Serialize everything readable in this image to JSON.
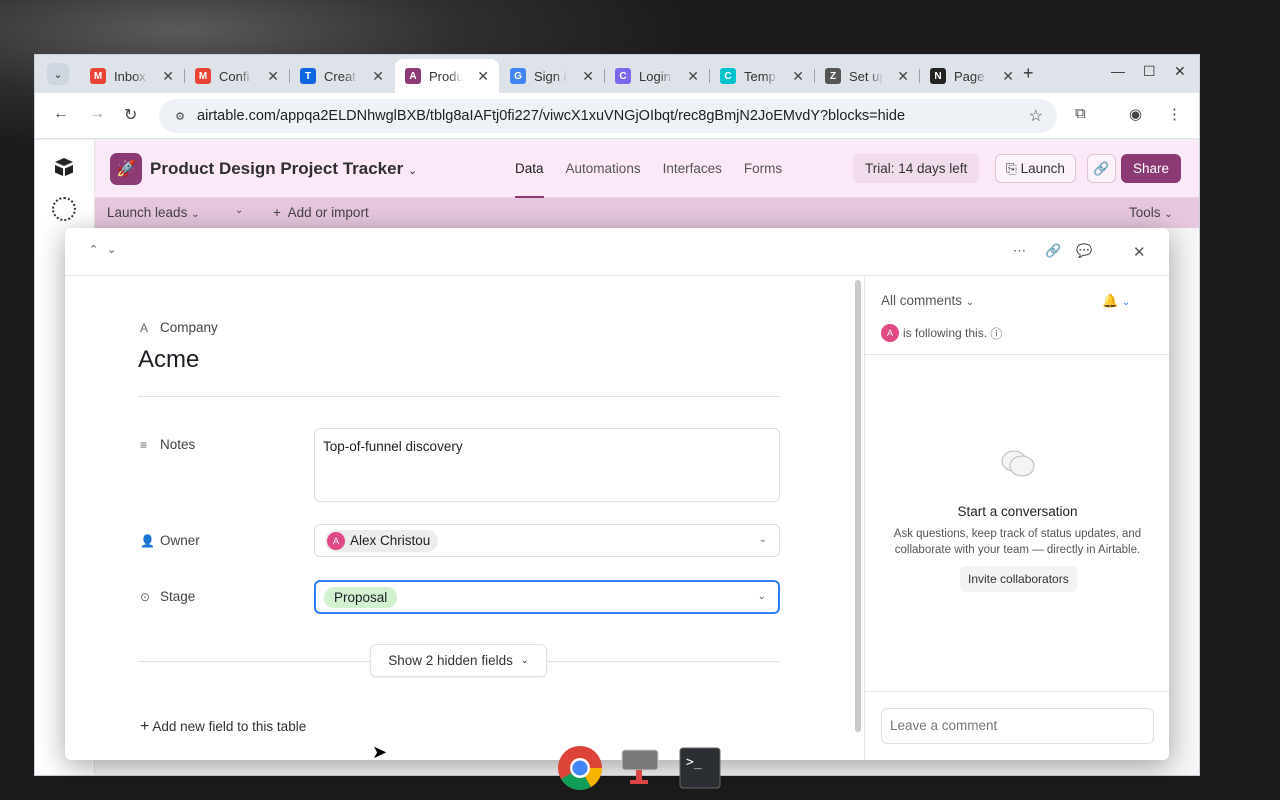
{
  "browser": {
    "tabs": [
      {
        "title": "Inbox",
        "icon": "gmail-icon",
        "color": "#ea4335",
        "letter": "M"
      },
      {
        "title": "Confi",
        "icon": "gmail-icon",
        "color": "#ea4335",
        "letter": "M"
      },
      {
        "title": "Creat",
        "icon": "trello-icon",
        "color": "#0c66e4",
        "letter": "T"
      },
      {
        "title": "Produ",
        "icon": "airtable-icon",
        "color": "#8b3a74",
        "letter": "A"
      },
      {
        "title": "Sign i",
        "icon": "google-icon",
        "color": "#4285f4",
        "letter": "G"
      },
      {
        "title": "Login",
        "icon": "clickup-icon",
        "color": "#7b68ee",
        "letter": "C"
      },
      {
        "title": "Temp",
        "icon": "canva-icon",
        "color": "#00c4cc",
        "letter": "C"
      },
      {
        "title": "Set up",
        "icon": "zapier-icon",
        "color": "#555555",
        "letter": "Z"
      },
      {
        "title": "Page",
        "icon": "notion-icon",
        "color": "#222222",
        "letter": "N"
      }
    ],
    "url": "airtable.com/appqa2ELDNhwglBXB/tblg8aIAFtj0fi227/viwcX1xuVNGjOIbqt/rec8gBmjN2JoEMvdY?blocks=hide"
  },
  "base": {
    "name": "Product Design Project Tracker",
    "nav_tabs": [
      "Data",
      "Automations",
      "Interfaces",
      "Forms"
    ],
    "trial": "Trial: 14 days left",
    "launch": "Launch",
    "share": "Share"
  },
  "subbar": {
    "table": "Launch leads",
    "add": "Add or import",
    "tools": "Tools"
  },
  "record": {
    "primary_field": "Company",
    "primary_value": "Acme",
    "fields": {
      "notes_label": "Notes",
      "notes_value": "Top-of-funnel discovery",
      "owner_label": "Owner",
      "owner_value": "Alex Christou",
      "owner_initial": "A",
      "stage_label": "Stage",
      "stage_value": "Proposal"
    },
    "hidden_fields": "Show 2 hidden fields",
    "add_field": "Add new field to this table"
  },
  "comments": {
    "filter": "All comments",
    "following": "is following this.",
    "follower_initial": "A",
    "empty_title": "Start a conversation",
    "empty_desc": "Ask questions, keep track of status updates, and collaborate with your team — directly in Airtable.",
    "invite": "Invite collaborators",
    "placeholder": "Leave a comment"
  },
  "colors": {
    "accent": "#8b3a74",
    "focus": "#2d7ff9",
    "stage_chip": "#d1f1cf"
  }
}
